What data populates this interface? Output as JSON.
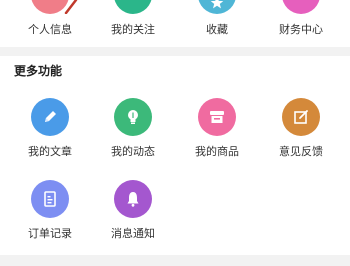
{
  "top_items": [
    {
      "label": "个人信息",
      "color": "#f07d88",
      "icon": "user-icon"
    },
    {
      "label": "我的关注",
      "color": "#2bb68a",
      "icon": "heart-icon"
    },
    {
      "label": "收藏",
      "color": "#4fb6d6",
      "icon": "star-icon"
    },
    {
      "label": "财务中心",
      "color": "#e65fbd",
      "icon": "wallet-icon"
    }
  ],
  "more": {
    "title": "更多功能",
    "items": [
      {
        "label": "我的文章",
        "color": "#4a9be8",
        "icon": "pencil-icon"
      },
      {
        "label": "我的动态",
        "color": "#3cb97a",
        "icon": "bulb-icon"
      },
      {
        "label": "我的商品",
        "color": "#f06ba0",
        "icon": "shop-icon"
      },
      {
        "label": "意见反馈",
        "color": "#d4893a",
        "icon": "edit-icon"
      },
      {
        "label": "订单记录",
        "color": "#7d8ef2",
        "icon": "document-icon"
      },
      {
        "label": "消息通知",
        "color": "#a457cf",
        "icon": "bell-icon"
      }
    ]
  }
}
